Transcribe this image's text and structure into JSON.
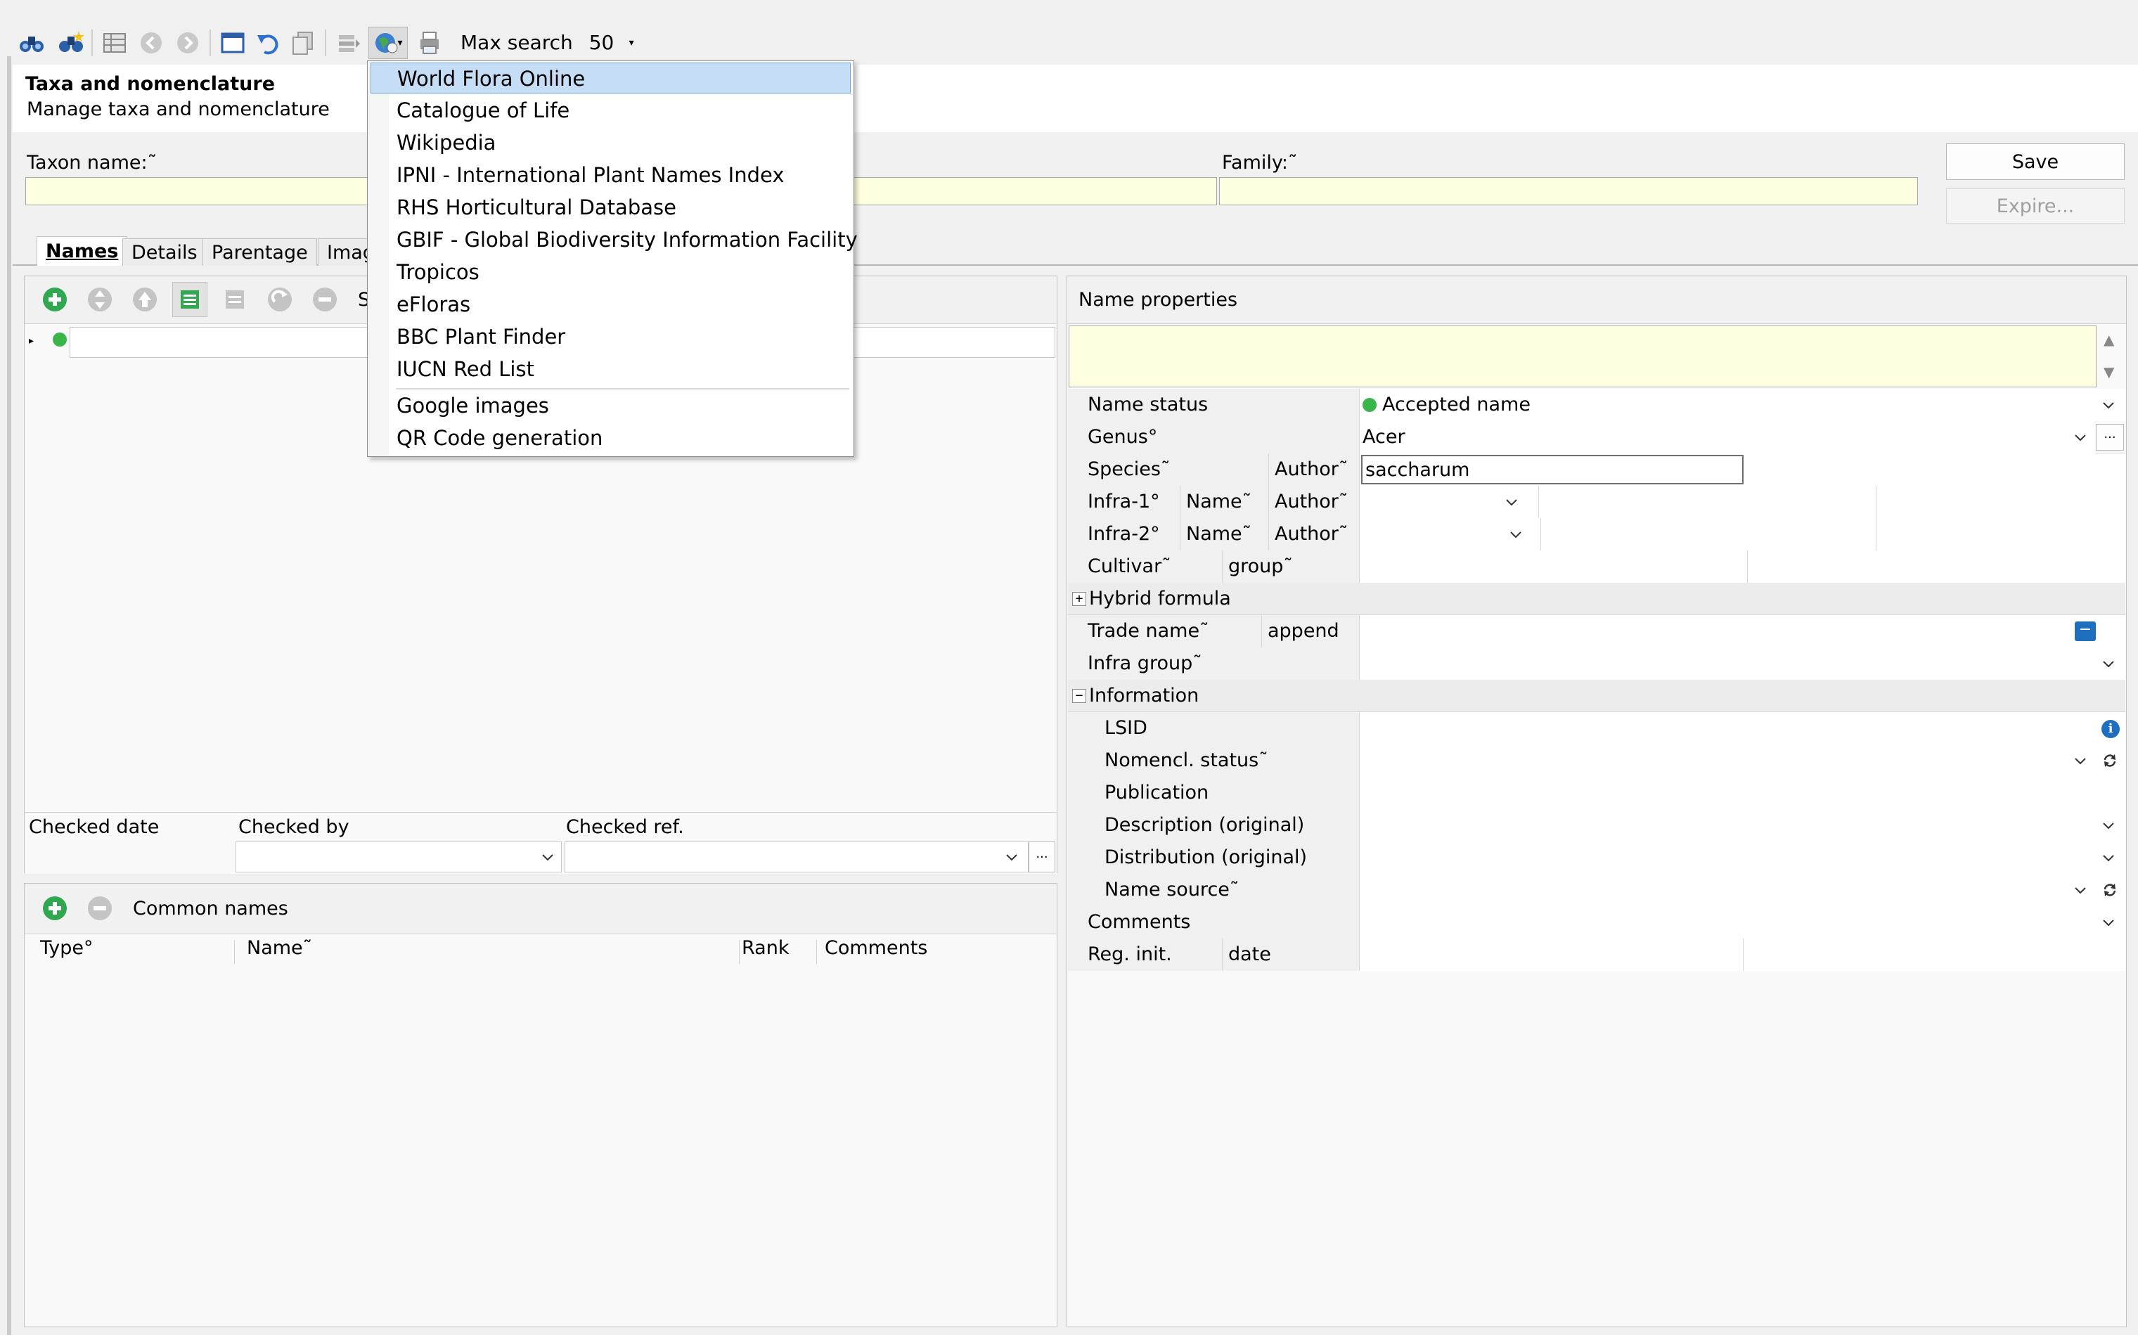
{
  "toolbar": {
    "icons": [
      "binoculars-icon",
      "binoculars-star-icon",
      "table-icon",
      "back-icon",
      "forward-icon",
      "window-icon",
      "undo-icon",
      "copy-icon",
      "stack-icon",
      "globe-icon",
      "printer-icon"
    ],
    "max_search_label": "Max search",
    "max_search_value": "50"
  },
  "header": {
    "title": "Taxa and nomenclature",
    "subtitle": "Manage taxa and nomenclature"
  },
  "form": {
    "taxon_name_label": "Taxon name:˜",
    "family_label": "Family:˜",
    "save_label": "Save",
    "expire_label": "Expire..."
  },
  "tabs": [
    {
      "label": "Names",
      "active": true
    },
    {
      "label": "Details"
    },
    {
      "label": "Parentage"
    },
    {
      "label": "Imag"
    }
  ],
  "names_panel": {
    "toolbar_icons": [
      "add-icon",
      "move-updown-icon",
      "move-up-icon",
      "list-icon",
      "list-gray-icon",
      "redo-icon",
      "remove-icon"
    ],
    "truncated_label": "S",
    "checked_date_label": "Checked date",
    "checked_by_label": "Checked by",
    "checked_ref_label": "Checked ref."
  },
  "common_names": {
    "title": "Common names",
    "columns": [
      "Type°",
      "Name˜",
      "Rank",
      "Comments"
    ]
  },
  "properties": {
    "title": "Name properties",
    "name_status_label": "Name status",
    "name_status_value": "Accepted name",
    "genus_label": "Genus°",
    "genus_value": "Acer",
    "species_label": "Species˜",
    "author_label": "Author˜",
    "species_value": "saccharum",
    "infra1_label": "Infra-1°",
    "infra2_label": "Infra-2°",
    "name_label": "Name˜",
    "cultivar_label": "Cultivar˜",
    "group_label": "group˜",
    "hybrid_formula_label": "Hybrid formula",
    "trade_name_label": "Trade name˜",
    "append_label": "append",
    "infra_group_label": "Infra group˜",
    "information_label": "Information",
    "lsid_label": "LSID",
    "nomencl_status_label": "Nomencl. status˜",
    "publication_label": "Publication",
    "description_label": "Description (original)",
    "distribution_label": "Distribution (original)",
    "name_source_label": "Name source˜",
    "comments_label": "Comments",
    "reg_init_label": "Reg. init.",
    "date_label": "date"
  },
  "menu": {
    "items": [
      "World Flora Online",
      "Catalogue of Life",
      "Wikipedia",
      "IPNI - International Plant Names Index",
      "RHS Horticultural Database",
      "GBIF - Global Biodiversity Information Facility",
      "Tropicos",
      "eFloras",
      "BBC Plant Finder",
      "IUCN Red List",
      "Google images",
      "QR Code generation"
    ]
  },
  "colors": {
    "field_yellow": "#ffffe1",
    "menu_highlight": "#c6ddf6",
    "accepted_green": "#3bb54a",
    "accent_blue": "#1f6fbf"
  }
}
